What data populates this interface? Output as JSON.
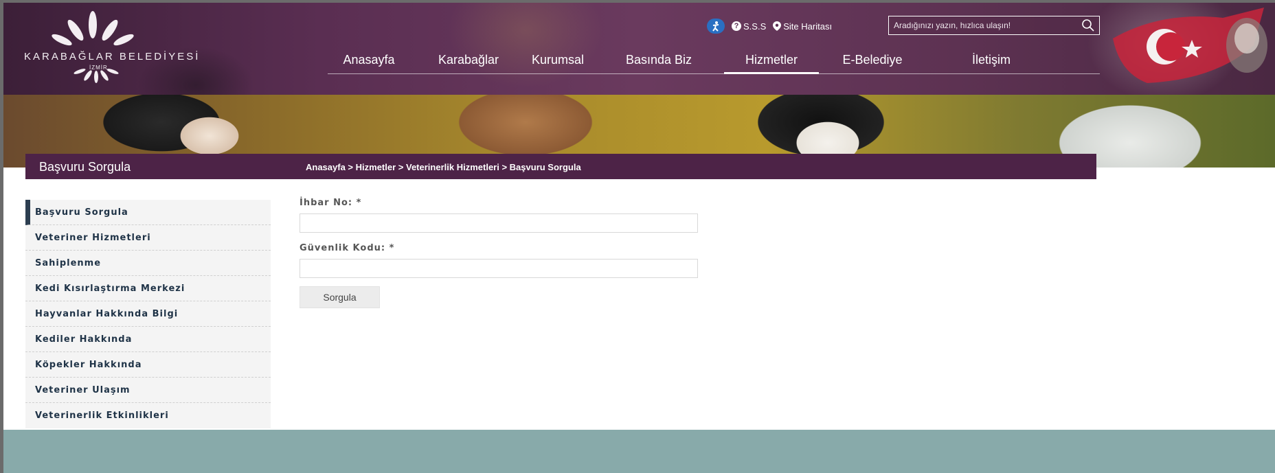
{
  "logo": {
    "name": "KARABAĞLAR BELEDİYESİ",
    "sub": "İZMİR"
  },
  "utility": {
    "faq": "S.S.S",
    "sitemap": "Site Haritası"
  },
  "search": {
    "placeholder": "Aradığınızı yazın, hızlıca ulaşın!"
  },
  "nav": {
    "items": [
      {
        "label": "Anasayfa"
      },
      {
        "label": "Karabağlar"
      },
      {
        "label": "Kurumsal"
      },
      {
        "label": "Basında Biz"
      },
      {
        "label": "Hizmetler"
      },
      {
        "label": "E-Belediye"
      },
      {
        "label": "İletişim"
      }
    ],
    "active": "Hizmetler"
  },
  "page": {
    "title": "Başvuru Sorgula",
    "breadcrumb": [
      "Anasayfa",
      "Hizmetler",
      "Veterinerlik Hizmetleri",
      "Başvuru Sorgula"
    ],
    "breadcrumb_sep": " > "
  },
  "sidebar": {
    "items": [
      {
        "label": "Başvuru Sorgula"
      },
      {
        "label": "Veteriner Hizmetleri"
      },
      {
        "label": "Sahiplenme"
      },
      {
        "label": "Kedi Kısırlaştırma Merkezi"
      },
      {
        "label": "Hayvanlar Hakkında Bilgi"
      },
      {
        "label": "Kediler Hakkında"
      },
      {
        "label": "Köpekler Hakkında"
      },
      {
        "label": "Veteriner Ulaşım"
      },
      {
        "label": "Veterinerlik Etkinlikleri"
      }
    ]
  },
  "form": {
    "field1_label": "İhbar No: *",
    "field1_value": "",
    "field2_label": "Güvenlik Kodu: *",
    "field2_value": "",
    "submit_label": "Sorgula"
  },
  "colors": {
    "header_purple": "#5a2e52",
    "title_bar": "#4d2347",
    "footer": "#88aaaa",
    "sidebar_text": "#1f3347"
  }
}
